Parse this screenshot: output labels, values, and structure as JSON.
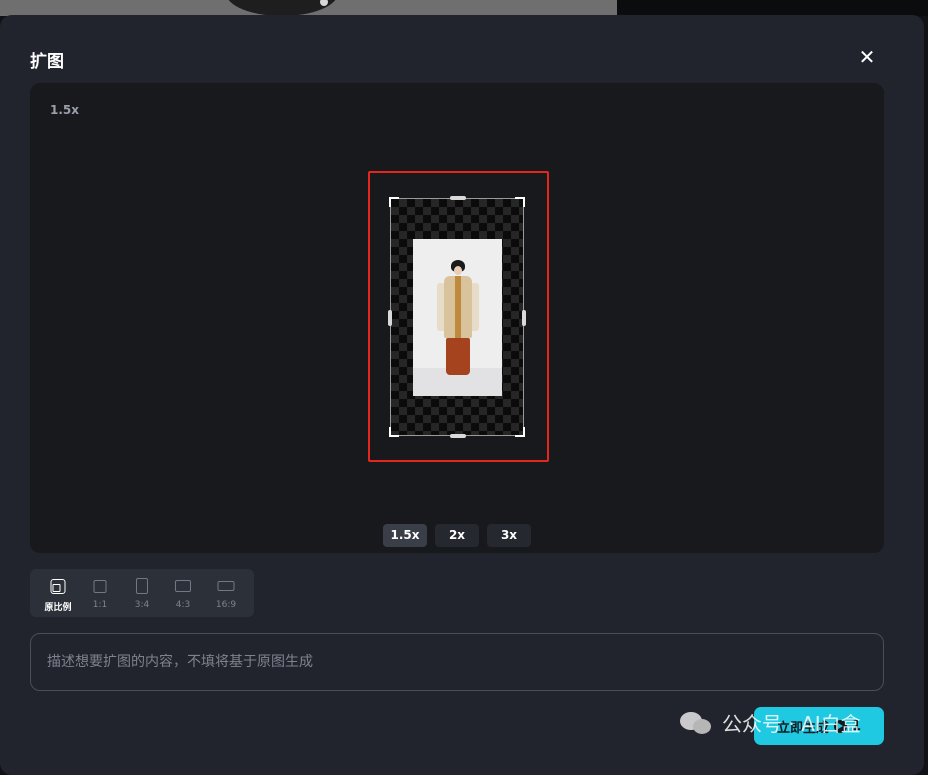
{
  "dialog": {
    "title": "扩图",
    "close_glyph": "✕"
  },
  "canvas": {
    "scale_label": "1.5x"
  },
  "scale_options": [
    {
      "label": "1.5x",
      "active": true
    },
    {
      "label": "2x",
      "active": false
    },
    {
      "label": "3x",
      "active": false
    }
  ],
  "aspect_ratios": [
    {
      "label": "原比例",
      "icon": "original-ratio-icon",
      "active": true
    },
    {
      "label": "1:1",
      "icon": "square-ratio-icon",
      "active": false
    },
    {
      "label": "3:4",
      "icon": "portrait-ratio-icon",
      "active": false
    },
    {
      "label": "4:3",
      "icon": "landscape-ratio-icon",
      "active": false
    },
    {
      "label": "16:9",
      "icon": "widescreen-ratio-icon",
      "active": false
    }
  ],
  "prompt": {
    "value": "",
    "placeholder": "描述想要扩图的内容，不填将基于原图生成"
  },
  "generate": {
    "label": "立即生成",
    "credit_icon": "credit-play-icon",
    "cost": "1"
  },
  "watermark": {
    "text": "公众号 · AI白盒"
  },
  "colors": {
    "accent": "#1fc9e1",
    "highlight": "#e4271c",
    "panel": "#21242c"
  }
}
